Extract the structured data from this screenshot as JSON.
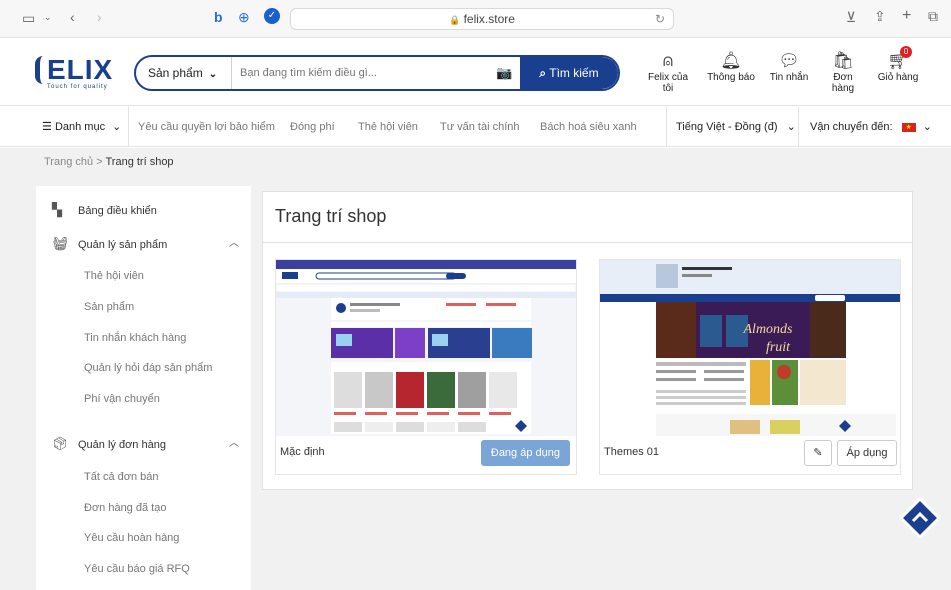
{
  "browser": {
    "url": "felix.store",
    "lock": "🔒"
  },
  "header": {
    "logo_text": "ELIX",
    "logo_tagline": "Touch for quality",
    "search": {
      "category": "Sản phẩm",
      "placeholder": "Bạn đang tìm kiếm điều gì...",
      "button": "Tìm kiếm"
    },
    "items": [
      {
        "label": "Felix của tôi",
        "icon": "user-icon"
      },
      {
        "label": "Thông báo",
        "icon": "bell-icon"
      },
      {
        "label": "Tin nhắn",
        "icon": "chat-icon"
      },
      {
        "label": "Đơn hàng",
        "icon": "order-icon"
      },
      {
        "label": "Giỏ hàng",
        "icon": "cart-icon",
        "badge": "0"
      }
    ]
  },
  "nav": {
    "menu": "Danh mục",
    "links": [
      "Yêu cầu quyền lợi bảo hiểm",
      "Đóng phí",
      "Thẻ hội viên",
      "Tư vấn tài chính",
      "Bách hoá siêu xanh"
    ],
    "language": "Tiếng Việt - Đồng (đ)",
    "shipping": "Vận chuyển đến:"
  },
  "breadcrumb": {
    "home": "Trang chủ",
    "sep": ">",
    "current": "Trang trí shop"
  },
  "sidebar": {
    "dashboard": "Bảng điều khiển",
    "products_group": "Quản lý sản phẩm",
    "products_items": [
      "Thẻ hội viên",
      "Sản phẩm",
      "Tin nhắn khách hàng",
      "Quản lý hỏi đáp sản phẩm",
      "Phí vận chuyển"
    ],
    "orders_group": "Quản lý đơn hàng",
    "orders_items": [
      "Tất cả đơn bán",
      "Đơn hàng đã tạo",
      "Yêu cầu hoàn hàng",
      "Yêu cầu báo giá RFQ"
    ]
  },
  "main": {
    "title": "Trang trí shop",
    "themes": [
      {
        "name": "Mặc định",
        "status": "Đang áp dụng"
      },
      {
        "name": "Themes 01",
        "apply": "Áp dụng"
      }
    ],
    "theme2_banner": {
      "line1": "Almonds",
      "line2": "fruit"
    }
  },
  "colors": {
    "brand": "#1a3f8f",
    "active_button": "#7aa5d6",
    "badge": "#e02020"
  }
}
